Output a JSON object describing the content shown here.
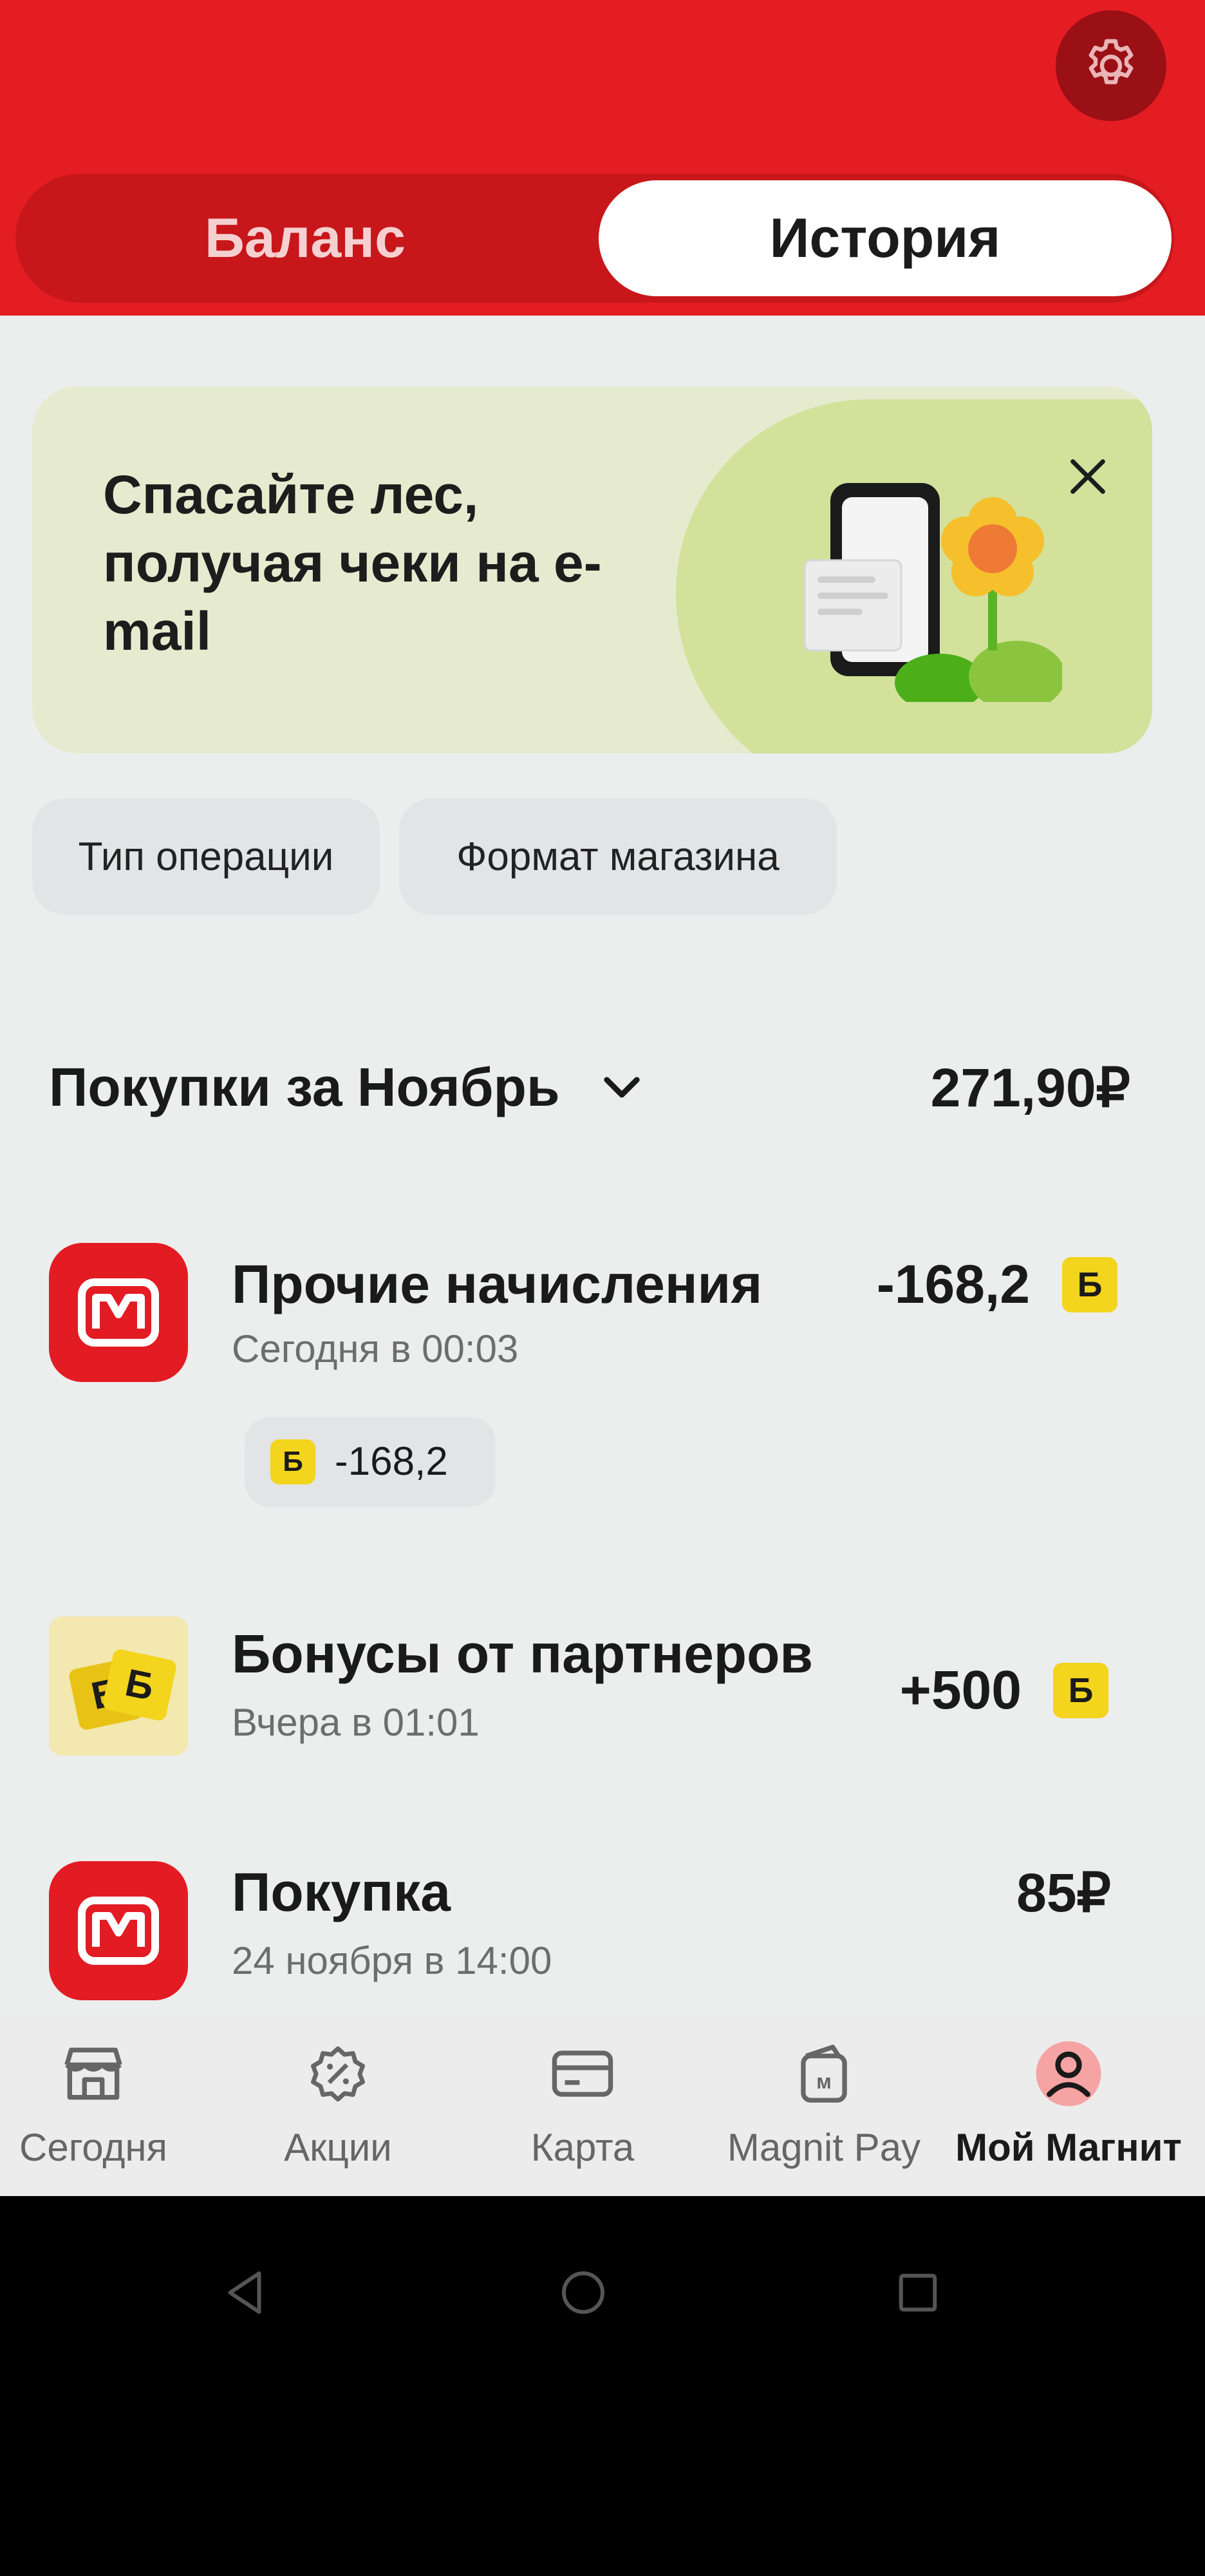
{
  "header": {
    "settings_icon": "gear-icon",
    "tabs": [
      {
        "label": "Баланс",
        "active": false
      },
      {
        "label": "История",
        "active": true
      }
    ],
    "accent_color": "#e41d23"
  },
  "promo": {
    "text": "Спасайте лес, получая чеки на e-mail",
    "close_icon": "close-icon",
    "illustration": "phone-receipt-flower"
  },
  "filters": [
    {
      "label": "Тип операции"
    },
    {
      "label": "Формат магазина"
    }
  ],
  "period": {
    "title": "Покупки за Ноябрь",
    "total": "271,90₽"
  },
  "transactions": [
    {
      "name": "Прочие начисления",
      "time": "Сегодня в 00:03",
      "amount": "-168,2",
      "currency_badge": "Б",
      "detail_amount": "-168,2",
      "icon": "magnit-logo-icon"
    },
    {
      "name": "Бонусы от партнеров",
      "time": "Вчера в 01:01",
      "amount": "+500",
      "currency_badge": "Б",
      "icon": "bonus-cards-icon"
    },
    {
      "name": "Покупка",
      "time": "24 ноября в 14:00",
      "amount": "85₽",
      "icon": "magnit-logo-icon"
    }
  ],
  "bottom_nav": [
    {
      "label": "Сегодня",
      "icon": "store-icon"
    },
    {
      "label": "Акции",
      "icon": "discount-badge-icon"
    },
    {
      "label": "Карта",
      "icon": "card-icon"
    },
    {
      "label": "Magnit Pay",
      "icon": "wallet-icon"
    },
    {
      "label": "Мой Магнит",
      "icon": "profile-icon",
      "active": true
    }
  ]
}
